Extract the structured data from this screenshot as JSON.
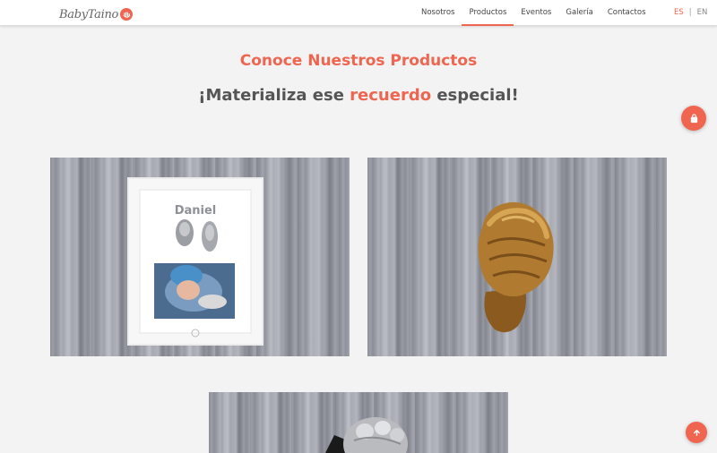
{
  "brand": {
    "logo_text": "BabyTaino"
  },
  "nav": {
    "items": [
      {
        "label": "Nosotros",
        "active": false
      },
      {
        "label": "Productos",
        "active": true
      },
      {
        "label": "Eventos",
        "active": false
      },
      {
        "label": "Galería",
        "active": false
      },
      {
        "label": "Contactos",
        "active": false
      }
    ]
  },
  "lang": {
    "es": "ES",
    "separator": "|",
    "en": "EN"
  },
  "hero": {
    "title": "Conoce Nuestros Productos",
    "subtitle_pre": "¡Materializa ese ",
    "subtitle_highlight": "recuerdo",
    "subtitle_post": " especial!"
  },
  "products": [
    {
      "frame_name": "Daniel"
    },
    {},
    {}
  ],
  "colors": {
    "accent": "#f0654f",
    "background": "#f3f3f3",
    "text": "#555555"
  },
  "icons": {
    "cart": "shopping-bag-icon",
    "scroll_top": "arrow-up-icon"
  }
}
